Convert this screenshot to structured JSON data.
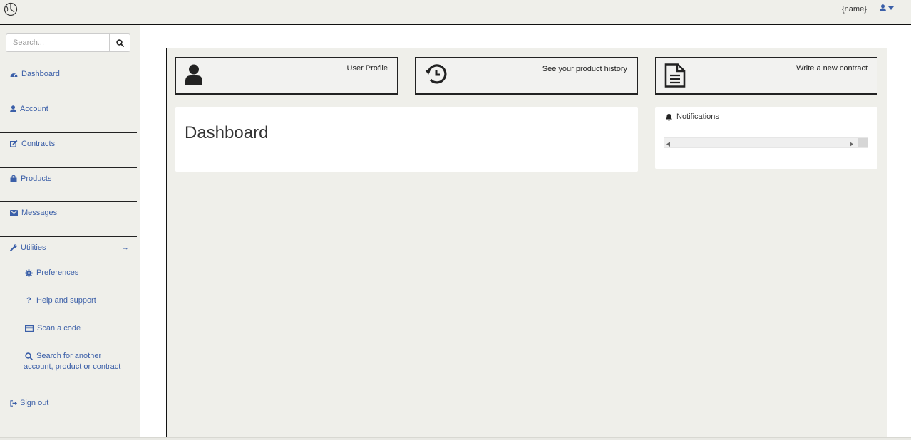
{
  "header": {
    "username": "{name}",
    "user_icon": "user-icon",
    "caret_icon": "caret-down-icon",
    "logo_icon": "brand-logo-icon"
  },
  "sidebar": {
    "search": {
      "placeholder": "Search...",
      "value": "",
      "button_icon": "search-icon"
    },
    "items": [
      {
        "label": "Dashboard",
        "icon": "dashboard-icon"
      },
      {
        "label": "Account",
        "icon": "user-icon"
      },
      {
        "label": "Contracts",
        "icon": "edit-icon"
      },
      {
        "label": "Products",
        "icon": "shopping-bag-icon"
      },
      {
        "label": "Messages",
        "icon": "envelope-icon"
      },
      {
        "label": "Utilities",
        "icon": "wrench-icon",
        "arrow": "→"
      }
    ],
    "utilities": [
      {
        "label": "Preferences",
        "icon": "gear-icon"
      },
      {
        "label": "Help and support",
        "icon": "question-icon"
      },
      {
        "label": "Scan a code",
        "icon": "credit-card-icon"
      },
      {
        "label_line1": "Search for another",
        "label_line2": "account, product or contract",
        "icon": "search-icon"
      }
    ],
    "signout": {
      "label": "Sign out",
      "icon": "sign-out-icon"
    }
  },
  "main": {
    "cards": [
      {
        "label": "User Profile",
        "icon": "user-icon"
      },
      {
        "label": "See your product history",
        "icon": "history-icon"
      },
      {
        "label": "Write a new contract",
        "icon": "file-text-icon"
      }
    ],
    "dashboard_title": "Dashboard",
    "notifications": {
      "title": "Notifications",
      "icon": "bell-icon"
    }
  },
  "colors": {
    "link": "#3b5fa8",
    "background": "#efefea",
    "panel": "#ffffff",
    "border": "#111111"
  }
}
